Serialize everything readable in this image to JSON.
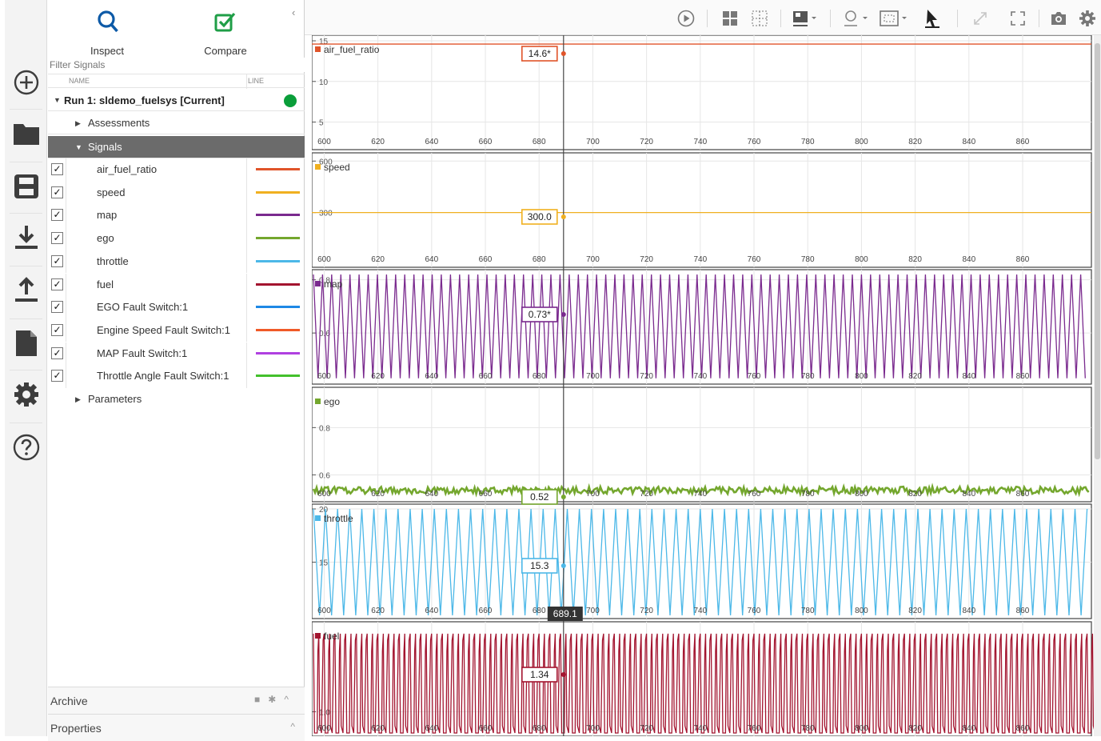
{
  "tabs": [
    {
      "label": "Inspect",
      "icon": "magnifier-icon",
      "active": true
    },
    {
      "label": "Compare",
      "icon": "checkmark-icon",
      "active": false
    }
  ],
  "filter": {
    "placeholder": "Filter Signals"
  },
  "columns": {
    "name": "NAME",
    "line": "LINE"
  },
  "run": {
    "label": "Run 1: sldemo_fuelsys [Current]",
    "status_color": "#0a9e3a"
  },
  "groups": {
    "assessments": "Assessments",
    "signals": "Signals",
    "parameters": "Parameters"
  },
  "signals": [
    {
      "name": "air_fuel_ratio",
      "color": "#e0542a",
      "checked": true
    },
    {
      "name": "speed",
      "color": "#f0b020",
      "checked": true
    },
    {
      "name": "map",
      "color": "#7a2a8e",
      "checked": true
    },
    {
      "name": "ego",
      "color": "#74a72e",
      "checked": true
    },
    {
      "name": "throttle",
      "color": "#4cb8e8",
      "checked": true
    },
    {
      "name": "fuel",
      "color": "#a3142f",
      "checked": true
    },
    {
      "name": "EGO Fault Switch:1",
      "color": "#1e88e5",
      "checked": true
    },
    {
      "name": "Engine Speed Fault Switch:1",
      "color": "#f05a28",
      "checked": true
    },
    {
      "name": "MAP Fault Switch:1",
      "color": "#b040e0",
      "checked": true
    },
    {
      "name": "Throttle Angle Fault Switch:1",
      "color": "#43c02c",
      "checked": true
    }
  ],
  "archive": {
    "label": "Archive"
  },
  "properties": {
    "label": "Properties"
  },
  "cursor": {
    "time": "689.1"
  },
  "xticks": [
    "600",
    "620",
    "640",
    "660",
    "680",
    "700",
    "720",
    "740",
    "760",
    "780",
    "800",
    "820",
    "840",
    "860"
  ],
  "xticks_values": [
    600,
    620,
    640,
    660,
    680,
    700,
    720,
    740,
    760,
    780,
    800,
    820,
    840,
    860
  ],
  "x_range": [
    596,
    885
  ],
  "cursor_x": 689.1,
  "plots": [
    {
      "signal": "air_fuel_ratio",
      "color": "#e0542a",
      "readout": "14.6*",
      "kind": "flat",
      "yticks": [
        {
          "label": "15",
          "v": 15
        },
        {
          "label": "10",
          "v": 10
        },
        {
          "label": "5",
          "v": 5
        }
      ],
      "y_range": [
        2,
        15.1
      ],
      "value": 14.6
    },
    {
      "signal": "speed",
      "color": "#f0b020",
      "readout": "300.0",
      "kind": "flat",
      "yticks": [
        {
          "label": "600",
          "v": 600
        },
        {
          "label": "300",
          "v": 300
        }
      ],
      "y_range": [
        0,
        620
      ],
      "value": 300
    },
    {
      "signal": "map",
      "color": "#7a2a8e",
      "readout": "0.73*",
      "kind": "tri",
      "period": 3.4,
      "yticks": [
        {
          "label": "0.8",
          "v": 0.8
        },
        {
          "label": "0.6",
          "v": 0.6
        }
      ],
      "y_range": [
        0.42,
        0.82
      ],
      "lo": 0.43,
      "hi": 0.82
    },
    {
      "signal": "ego",
      "color": "#74a72e",
      "readout": "0.52",
      "kind": "noise",
      "yticks": [
        {
          "label": "0.8",
          "v": 0.8
        },
        {
          "label": "0.6",
          "v": 0.6
        }
      ],
      "y_range": [
        0.5,
        0.95
      ],
      "value": 0.52
    },
    {
      "signal": "throttle",
      "color": "#4cb8e8",
      "readout": "15.3",
      "kind": "tri",
      "period": 4.5,
      "yticks": [
        {
          "label": "20",
          "v": 20
        },
        {
          "label": "15",
          "v": 15
        }
      ],
      "y_range": [
        10,
        20
      ],
      "lo": 10,
      "hi": 20
    },
    {
      "signal": "fuel",
      "color": "#a3142f",
      "readout": "1.34",
      "kind": "pulse",
      "period": 4.0,
      "yticks": [
        {
          "label": "1.0",
          "v": 1.0
        }
      ],
      "y_range": [
        0.85,
        1.6
      ],
      "lo": 0.85,
      "hi": 1.55
    }
  ]
}
